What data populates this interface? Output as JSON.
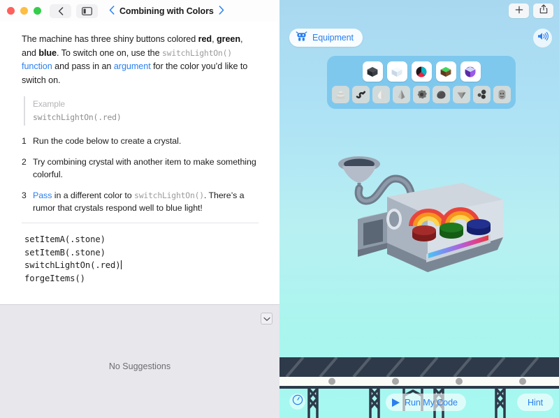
{
  "window": {
    "traffic_lights": [
      "close",
      "minimize",
      "zoom"
    ],
    "back_button_icon": "chevron-left-icon",
    "sidebar_toggle_icon": "sidebar-toggle-icon",
    "doc_prev_icon": "chevron-left-icon",
    "doc_next_icon": "chevron-right-icon",
    "title": "Combining with Colors"
  },
  "instructions": {
    "paragraph": {
      "p1": "The machine has three shiny buttons colored ",
      "red": "red",
      "c1": ", ",
      "green": "green",
      "c2": ", and ",
      "blue": "blue",
      "p2": ". To switch one on, use the ",
      "code1": "switchLightOn()",
      "p3": " ",
      "link_function": "function",
      "p4": " and pass in an ",
      "link_argument": "argument",
      "p5": " for the color you’d like to switch on."
    },
    "example": {
      "label": "Example",
      "code": "switchLightOn(.red)"
    },
    "steps": [
      {
        "num": "1",
        "text": "Run the code below to create a crystal."
      },
      {
        "num": "2",
        "text": "Try combining crystal with another item to make something colorful."
      },
      {
        "num": "3",
        "link": "Pass",
        "text_a": " in a different color to ",
        "code": "switchLightOn()",
        "text_b": ". There’s a rumor that crystals respond well to blue light!"
      }
    ]
  },
  "editor": {
    "lines": [
      "setItemA(.stone)",
      "setItemB(.stone)",
      "switchLightOn(.red)",
      "forgeItems()"
    ],
    "caret_line_index": 2
  },
  "suggestions": {
    "empty_message": "No Suggestions",
    "collapse_icon": "chevron-down-icon"
  },
  "live_view": {
    "add_button_icon": "plus-icon",
    "share_button_icon": "share-icon",
    "sound_button_icon": "speaker-wave-icon",
    "equipment": {
      "icon": "robot-icon",
      "label": "Equipment",
      "active_items": [
        "coal",
        "ice-cube",
        "ruby-cube",
        "emerald-grass-cube",
        "crystal-cube"
      ],
      "dim_items": [
        "shell-stack",
        "ribbon",
        "droplet",
        "spike",
        "gear-rock",
        "boulder",
        "diamond",
        "pebbles",
        "stone-face"
      ]
    },
    "machine": {
      "name": "forge-machine",
      "buttons": [
        "red",
        "green",
        "blue"
      ],
      "button_colors": [
        "#9e2a28",
        "#1f7a1f",
        "#1f2a8f"
      ],
      "rainbow_count": 2,
      "light_bar_colors": [
        "#49c4f2",
        "#7d8df0",
        "#b35ed8",
        "#e0408a",
        "#e33a3a"
      ]
    },
    "controls": {
      "speed_icon": "gauge-icon",
      "run_icon": "play-icon",
      "run_label": "Run My Code",
      "hint_label": "Hint"
    }
  },
  "colors": {
    "accent_blue": "#2a7ff0",
    "sky_top": "#a8d8f0",
    "sky_bottom": "#a5f8f0",
    "tray_blue": "#7ec8ee",
    "suggest_bg": "#e7e7ec",
    "ground_dark": "#2e3a4a"
  }
}
